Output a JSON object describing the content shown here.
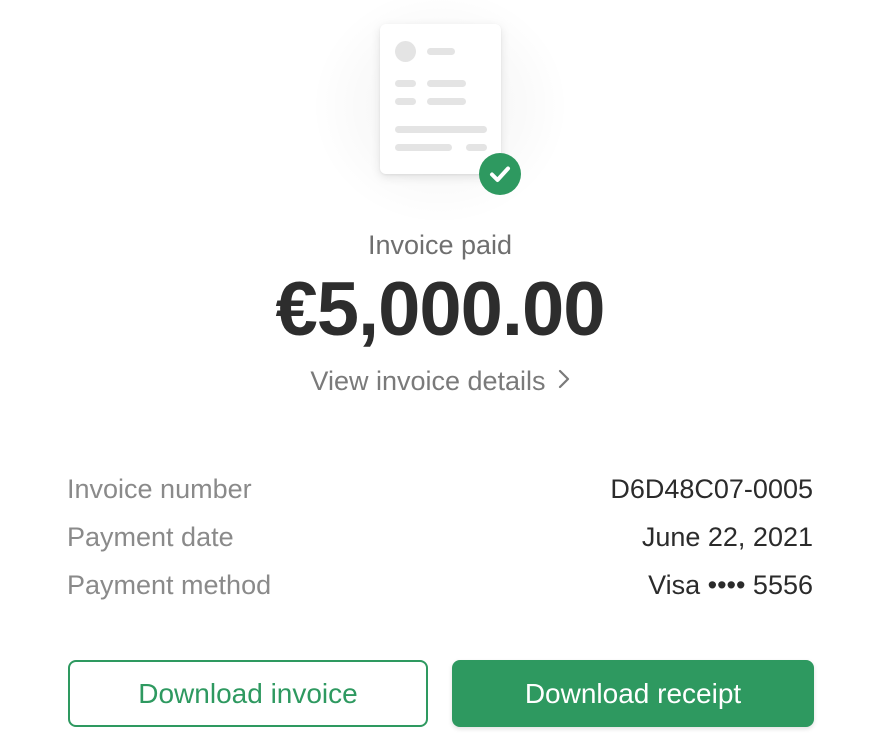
{
  "status": {
    "label": "Invoice paid",
    "icon": "check-icon",
    "illustration": "invoice-document-icon"
  },
  "amount": "€5,000.00",
  "details_link": {
    "label": "View invoice details",
    "icon": "chevron-right-icon"
  },
  "info": [
    {
      "label": "Invoice number",
      "value": "D6D48C07-0005"
    },
    {
      "label": "Payment date",
      "value": "June 22, 2021"
    },
    {
      "label": "Payment method",
      "value": "Visa •••• 5556"
    }
  ],
  "actions": {
    "download_invoice": "Download invoice",
    "download_receipt": "Download receipt"
  },
  "colors": {
    "accent": "#2e9960",
    "text_primary": "#2d2d2d",
    "text_secondary": "#8a8a8a",
    "placeholder": "#e4e4e4"
  }
}
